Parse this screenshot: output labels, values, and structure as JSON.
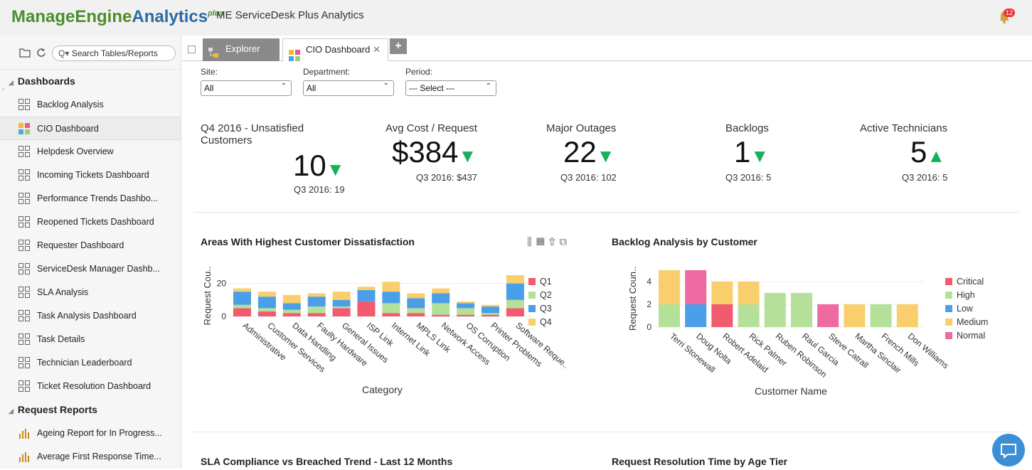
{
  "header": {
    "logo_part1": "ManageEngine",
    "logo_part2": "Analytics",
    "logo_plus": "plus",
    "app_title": "ME ServiceDesk Plus Analytics",
    "notification_count": "12"
  },
  "sidebar": {
    "search_placeholder": "Search Tables/Reports",
    "sections": [
      {
        "label": "Dashboards",
        "items": [
          {
            "label": "Backlog Analysis"
          },
          {
            "label": "CIO Dashboard"
          },
          {
            "label": "Helpdesk Overview"
          },
          {
            "label": "Incoming Tickets Dashboard"
          },
          {
            "label": "Performance Trends Dashbo..."
          },
          {
            "label": "Reopened Tickets Dashboard"
          },
          {
            "label": "Requester Dashboard"
          },
          {
            "label": "ServiceDesk Manager Dashb..."
          },
          {
            "label": "SLA Analysis"
          },
          {
            "label": "Task Analysis Dashboard"
          },
          {
            "label": "Task Details"
          },
          {
            "label": "Technician Leaderboard"
          },
          {
            "label": "Ticket Resolution Dashboard"
          }
        ]
      },
      {
        "label": "Request Reports",
        "items": [
          {
            "label": "Ageing Report for In Progress..."
          },
          {
            "label": "Average First Response Time..."
          }
        ]
      }
    ]
  },
  "tabs": [
    {
      "label": "Explorer"
    },
    {
      "label": "CIO Dashboard"
    }
  ],
  "filters": [
    {
      "label": "Site:",
      "value": "All"
    },
    {
      "label": "Department:",
      "value": "All"
    },
    {
      "label": "Period:",
      "value": "--- Select ---"
    }
  ],
  "kpis": [
    {
      "title": "Q4 2016 - Unsatisfied Customers",
      "value": "10",
      "trend": "down",
      "previous": "Q3 2016: 19"
    },
    {
      "title": "Avg Cost / Request",
      "value": "$384",
      "trend": "down",
      "previous": "Q3 2016: $437"
    },
    {
      "title": "Major Outages",
      "value": "22",
      "trend": "down",
      "previous": "Q3 2016: 102"
    },
    {
      "title": "Backlogs",
      "value": "1",
      "trend": "down",
      "previous": "Q3 2016: 5"
    },
    {
      "title": "Active Technicians",
      "value": "5",
      "trend": "up",
      "previous": "Q3 2016: 5"
    }
  ],
  "colors": {
    "q1": "#f25a6e",
    "q2": "#b5e09a",
    "q3": "#4a9fe8",
    "q4": "#f8cf6c",
    "critical": "#f25a6e",
    "high": "#b5e09a",
    "low": "#4a9fe8",
    "medium": "#f8cf6c",
    "normal": "#ee6aa0",
    "trend_green": "#18b15b",
    "chat_blue": "#3b8fd6"
  },
  "chart_data": [
    {
      "type": "bar",
      "stacked": true,
      "title": "Areas With Highest Customer Dissatisfaction",
      "xlabel": "Category",
      "ylabel": "Request Cou..",
      "ylim": [
        0,
        25
      ],
      "yticks": [
        0,
        20
      ],
      "categories": [
        "Administrative",
        "Customer Services",
        "Data Handling",
        "Faulty Hardware",
        "General Issues",
        "ISP Link",
        "Internet Link",
        "MPLS Link",
        "Network Access",
        "OS Corruption",
        "Printer Problems",
        "Software Reque.."
      ],
      "series": [
        {
          "name": "Q1",
          "values": [
            5,
            3,
            2,
            2,
            5,
            9,
            2,
            2,
            1,
            1,
            1,
            5
          ]
        },
        {
          "name": "Q2",
          "values": [
            2,
            2,
            2,
            4,
            1,
            0,
            6,
            3,
            7,
            4,
            1,
            5
          ]
        },
        {
          "name": "Q3",
          "values": [
            8,
            7,
            4,
            6,
            4,
            7,
            7,
            6,
            6,
            3,
            4,
            10
          ]
        },
        {
          "name": "Q4",
          "values": [
            2,
            3,
            5,
            2,
            5,
            2,
            6,
            3,
            3,
            1,
            1,
            5
          ]
        }
      ],
      "legend": "right"
    },
    {
      "type": "bar",
      "stacked": true,
      "title": "Backlog Analysis by Customer",
      "xlabel": "Customer Name",
      "ylabel": "Request Coun..",
      "ylim": [
        0,
        5
      ],
      "yticks": [
        0,
        2,
        4
      ],
      "categories": [
        "Terri Stonewall",
        "Doug Nolta",
        "Robert Adelaid",
        "Rick Palmer",
        "Ruben Robinson",
        "Raul Garcia",
        "Steve Catrall",
        "Martha Sinclair",
        "French Mills",
        "Don Williams"
      ],
      "series": [
        {
          "name": "Critical",
          "values": [
            0,
            0,
            2,
            0,
            0,
            0,
            0,
            0,
            0,
            0
          ]
        },
        {
          "name": "High",
          "values": [
            2,
            0,
            0,
            2,
            3,
            3,
            0,
            0,
            2,
            0
          ]
        },
        {
          "name": "Low",
          "values": [
            0,
            2,
            0,
            0,
            0,
            0,
            0,
            0,
            0,
            0
          ]
        },
        {
          "name": "Medium",
          "values": [
            3,
            0,
            2,
            2,
            0,
            0,
            0,
            2,
            0,
            2
          ]
        },
        {
          "name": "Normal",
          "values": [
            0,
            3,
            0,
            0,
            0,
            0,
            2,
            0,
            0,
            0
          ]
        }
      ],
      "legend": "right"
    }
  ],
  "bottom_titles": [
    "SLA Compliance vs Breached Trend - Last 12 Months",
    "Request Resolution Time by Age Tier"
  ]
}
